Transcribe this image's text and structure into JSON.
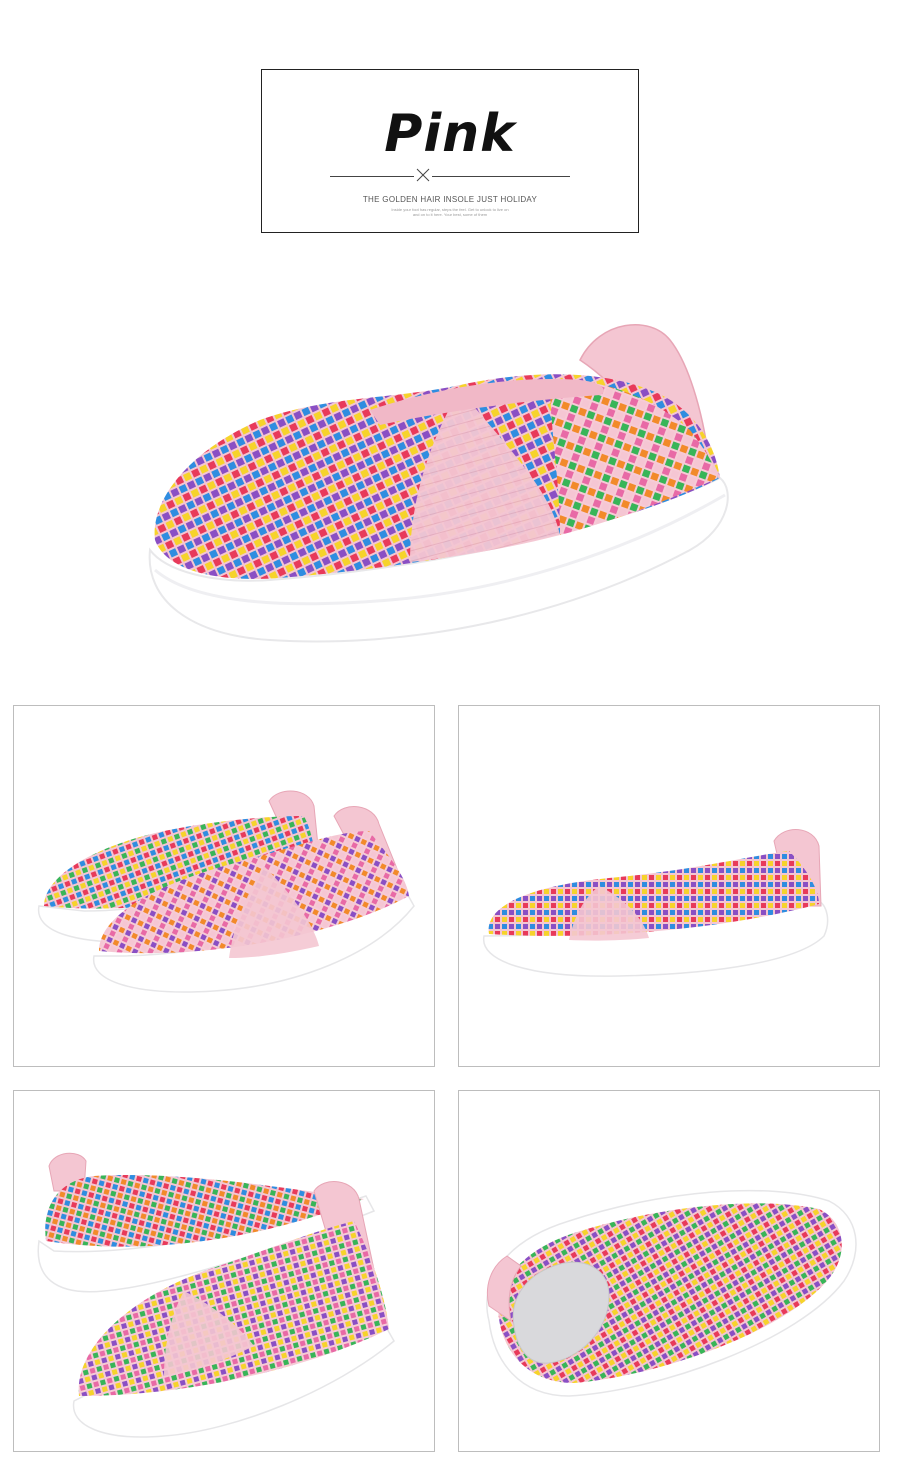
{
  "header": {
    "title": "Pink",
    "subtitle": "THE GOLDEN HAIR INSOLE JUST HOLIDAY",
    "fine_print": "Inside your foot has regular, steps the feel. Get to unlock to live on",
    "fine_print_2": "and on to it here. Your best, some of them"
  },
  "colors": {
    "pink": "#f4c6d2",
    "pink_dark": "#e7a6b6",
    "sole": "#ffffff",
    "weave": [
      "#e83a5a",
      "#f28a2a",
      "#f6d32b",
      "#38b558",
      "#2f8de0",
      "#8a4fc4",
      "#e86aa6",
      "#ff6f3c",
      "#f5c6d3"
    ]
  },
  "images": [
    {
      "name": "hero-shoe-photo"
    },
    {
      "name": "pair-front-photo"
    },
    {
      "name": "side-view-photo"
    },
    {
      "name": "pair-angled-photo"
    },
    {
      "name": "top-view-photo"
    }
  ]
}
